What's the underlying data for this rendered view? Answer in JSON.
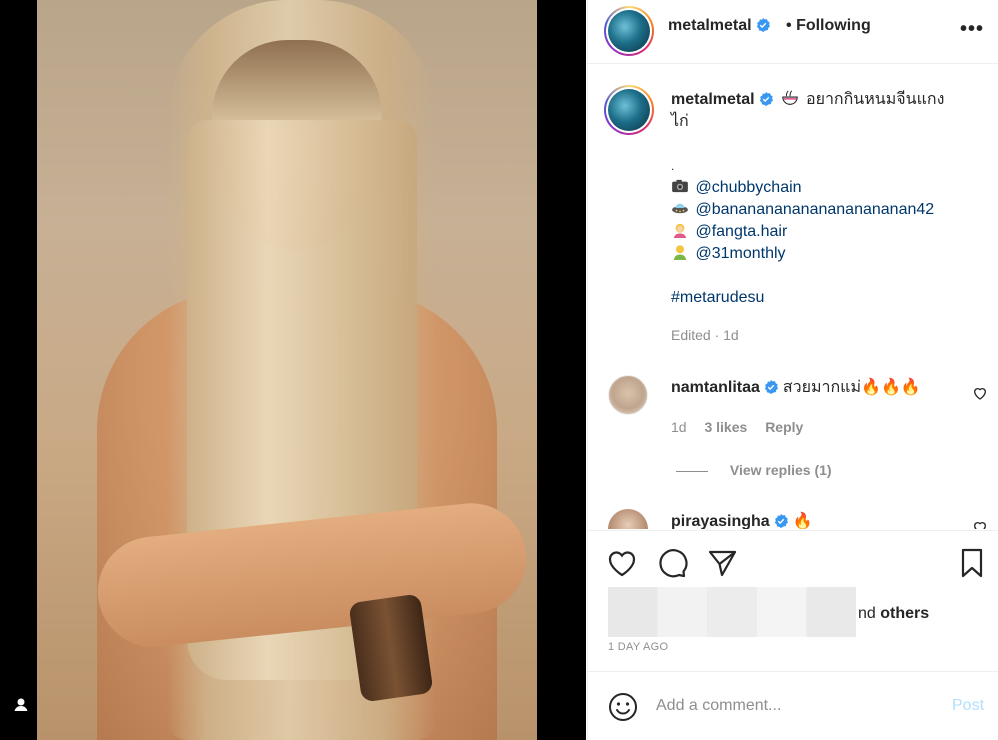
{
  "post": {
    "username": "metalmetal",
    "follow_separator": "•",
    "follow_status": "Following",
    "more_label": "•••"
  },
  "caption": {
    "username": "metalmetal",
    "line1": "อยากกินหนมจีนแกง",
    "line2": "ไก่",
    "dot": ".",
    "credits": [
      {
        "icon": "camera-icon",
        "handle": "@chubbychain"
      },
      {
        "icon": "ufo-icon",
        "handle": "@bananananananananananan42"
      },
      {
        "icon": "hairdresser-icon",
        "handle": "@fangta.hair"
      },
      {
        "icon": "person-icon",
        "handle": "@31monthly"
      }
    ],
    "hashtag": "#metarudesu",
    "edited": "Edited · 1d"
  },
  "comments": [
    {
      "username": "namtanlitaa",
      "text": "สวยมากแม่🔥🔥🔥",
      "time": "1d",
      "likes": "3 likes",
      "reply_label": "Reply",
      "view_replies": "View replies (1)"
    },
    {
      "username": "pirayasingha",
      "text": "🔥"
    }
  ],
  "actions": {
    "likes_suffix_pre": "nd ",
    "likes_suffix_bold": "others",
    "time_ago": "1 DAY AGO"
  },
  "comment_box": {
    "placeholder": "Add a comment...",
    "post_label": "Post"
  },
  "colors": {
    "accent": "#0095f6",
    "mention": "#00376b",
    "verified": "#3897f0",
    "post_disabled": "#b2dffc"
  }
}
